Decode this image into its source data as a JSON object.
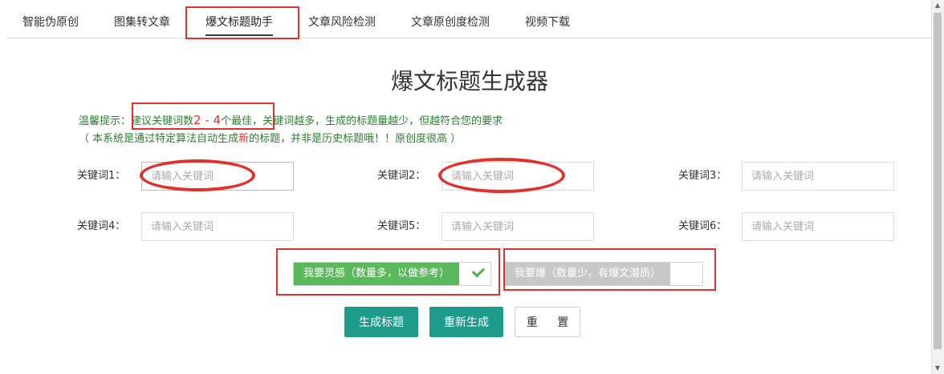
{
  "tabs": [
    {
      "label": "智能伪原创"
    },
    {
      "label": "图集转文章"
    },
    {
      "label": "爆文标题助手",
      "active": true
    },
    {
      "label": "文章风险检测"
    },
    {
      "label": "文章原创度检测"
    },
    {
      "label": "视频下载"
    }
  ],
  "title": "爆文标题生成器",
  "tips": {
    "prefix": "温馨提示：",
    "suggest_a": "建议关键词数",
    "suggest_range": "2 - 4",
    "suggest_b": "个最佳",
    "rest": "，关键词越多，生成的标题量越少，但越符合您的要求",
    "line2_a": "（ 本系统是通过特定算法自动生成",
    "line2_new": "新",
    "line2_b": "的标题，并非是历史标题哦！！原创度很高 ）"
  },
  "keywords": [
    {
      "label": "关键词1：",
      "value": "",
      "placeholder": "请输入关键词"
    },
    {
      "label": "关键词2：",
      "value": "",
      "placeholder": "请输入关键词"
    },
    {
      "label": "关键词3：",
      "value": "",
      "placeholder": "请输入关键词"
    },
    {
      "label": "关键词4：",
      "value": "",
      "placeholder": "请输入关键词"
    },
    {
      "label": "关键词5：",
      "value": "",
      "placeholder": "请输入关键词"
    },
    {
      "label": "关键词6：",
      "value": "",
      "placeholder": "请输入关键词"
    }
  ],
  "modes": [
    {
      "label": "我要灵感（数量多，以做参考）",
      "selected": true,
      "color": "#5cb85c"
    },
    {
      "label": "我要爆（数量少，有爆文潜质）",
      "selected": false,
      "color": "#c8c8c8"
    }
  ],
  "buttons": {
    "generate": "生成标题",
    "regenerate": "重新生成",
    "reset": "重 置"
  },
  "colors": {
    "accent": "#1e9b8a",
    "tip_text": "#2e7d32",
    "highlight": "#e0322c"
  }
}
